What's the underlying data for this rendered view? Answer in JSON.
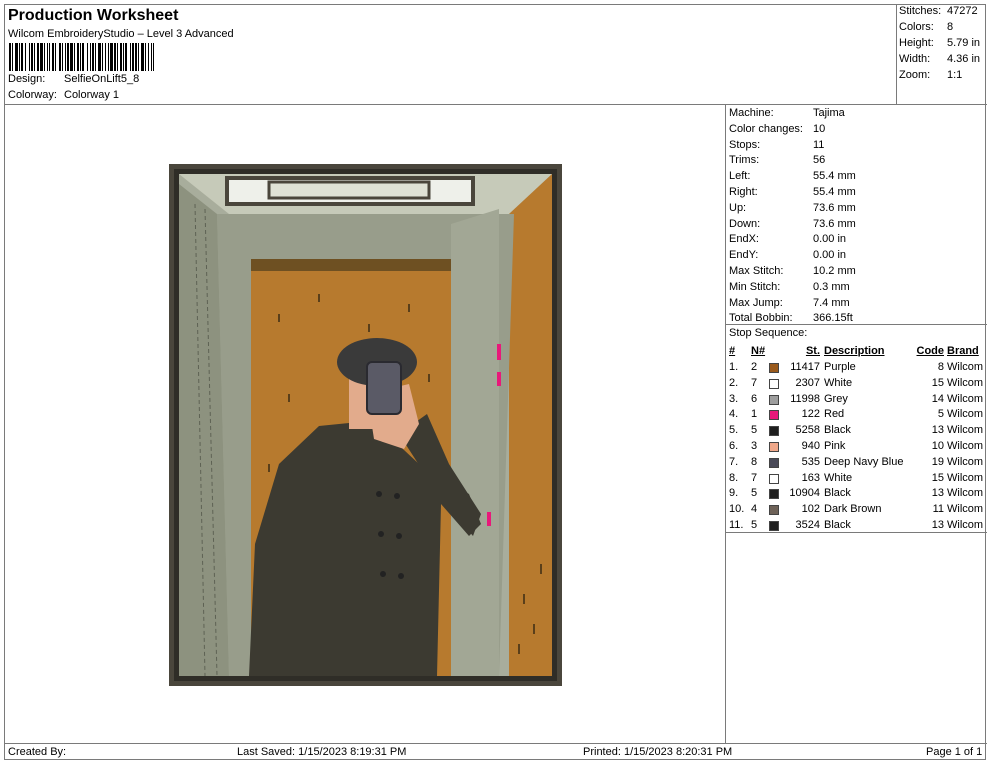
{
  "header": {
    "title": "Production Worksheet",
    "software": "Wilcom EmbroideryStudio – Level 3 Advanced",
    "design_label": "Design:",
    "design_value": "SelfieOnLift5_8",
    "colorway_label": "Colorway:",
    "colorway_value": "Colorway 1"
  },
  "stats": [
    {
      "label": "Stitches:",
      "value": "47272"
    },
    {
      "label": "Colors:",
      "value": "8"
    },
    {
      "label": "Height:",
      "value": "5.79 in"
    },
    {
      "label": "Width:",
      "value": "4.36 in"
    },
    {
      "label": "Zoom:",
      "value": "1:1"
    }
  ],
  "machine": [
    {
      "label": "Machine:",
      "value": "Tajima"
    },
    {
      "label": "Color changes:",
      "value": "10"
    },
    {
      "label": "Stops:",
      "value": "11"
    },
    {
      "label": "Trims:",
      "value": "56"
    },
    {
      "label": "Left:",
      "value": "55.4 mm"
    },
    {
      "label": "Right:",
      "value": "55.4 mm"
    },
    {
      "label": "Up:",
      "value": "73.6 mm"
    },
    {
      "label": "Down:",
      "value": "73.6 mm"
    },
    {
      "label": "EndX:",
      "value": "0.00 in"
    },
    {
      "label": "EndY:",
      "value": "0.00 in"
    },
    {
      "label": "Max Stitch:",
      "value": "10.2 mm"
    },
    {
      "label": "Min Stitch:",
      "value": "0.3 mm"
    },
    {
      "label": "Max Jump:",
      "value": "7.4 mm"
    },
    {
      "label": "Total Bobbin:",
      "value": "366.15ft"
    }
  ],
  "stop_sequence": {
    "title": "Stop Sequence:",
    "headers": {
      "num": "#",
      "n": "N#",
      "st": "St.",
      "desc": "Description",
      "code": "Code",
      "brand": "Brand"
    },
    "rows": [
      {
        "num": "1.",
        "n": "2",
        "color": "#9a5a1c",
        "st": "11417",
        "desc": "Purple",
        "code": "8",
        "brand": "Wilcom"
      },
      {
        "num": "2.",
        "n": "7",
        "color": "#ffffff",
        "st": "2307",
        "desc": "White",
        "code": "15",
        "brand": "Wilcom"
      },
      {
        "num": "3.",
        "n": "6",
        "color": "#9e9e9e",
        "st": "11998",
        "desc": "Grey",
        "code": "14",
        "brand": "Wilcom"
      },
      {
        "num": "4.",
        "n": "1",
        "color": "#e8187a",
        "st": "122",
        "desc": "Red",
        "code": "5",
        "brand": "Wilcom"
      },
      {
        "num": "5.",
        "n": "5",
        "color": "#1e1e1e",
        "st": "5258",
        "desc": "Black",
        "code": "13",
        "brand": "Wilcom"
      },
      {
        "num": "6.",
        "n": "3",
        "color": "#f0a88a",
        "st": "940",
        "desc": "Pink",
        "code": "10",
        "brand": "Wilcom"
      },
      {
        "num": "7.",
        "n": "8",
        "color": "#4a4a58",
        "st": "535",
        "desc": "Deep Navy Blue",
        "code": "19",
        "brand": "Wilcom"
      },
      {
        "num": "8.",
        "n": "7",
        "color": "#ffffff",
        "st": "163",
        "desc": "White",
        "code": "15",
        "brand": "Wilcom"
      },
      {
        "num": "9.",
        "n": "5",
        "color": "#1e1e1e",
        "st": "10904",
        "desc": "Black",
        "code": "13",
        "brand": "Wilcom"
      },
      {
        "num": "10.",
        "n": "4",
        "color": "#6e6258",
        "st": "102",
        "desc": "Dark Brown",
        "code": "11",
        "brand": "Wilcom"
      },
      {
        "num": "11.",
        "n": "5",
        "color": "#1e1e1e",
        "st": "3524",
        "desc": "Black",
        "code": "13",
        "brand": "Wilcom"
      }
    ]
  },
  "footer": {
    "created_by": "Created By:",
    "last_saved": "Last Saved: 1/15/2023 8:19:31 PM",
    "printed": "Printed: 1/15/2023 8:20:31 PM",
    "page": "Page 1 of 1"
  },
  "design_colors": {
    "frame": "#4a463c",
    "wall": "#a8ad9c",
    "wall_dark": "#8d927f",
    "brown": "#b77a2e",
    "coat": "#3c3a31",
    "skin": "#e2ab8c",
    "hair": "#3a3a3a",
    "phone": "#5a5a66",
    "pink": "#e8187a",
    "white": "#eef0ea"
  }
}
